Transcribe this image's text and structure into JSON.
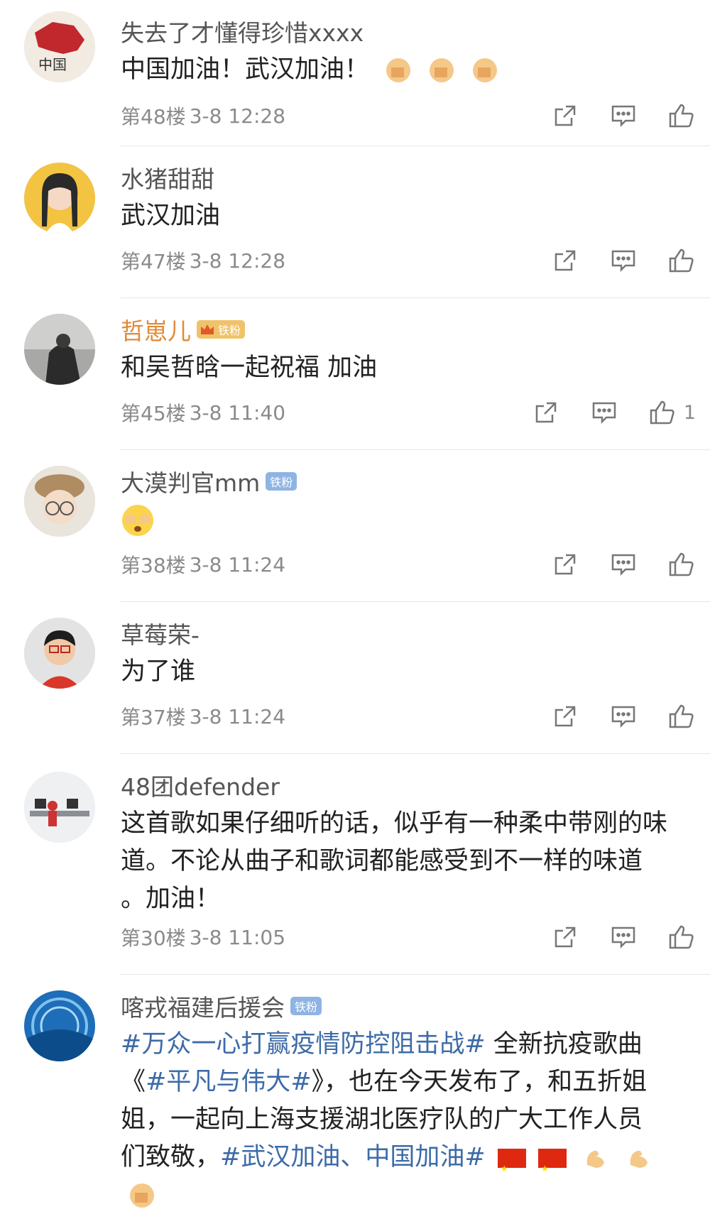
{
  "comments": [
    {
      "name": "失去了才懂得珍惜xxxx",
      "text": "中国加油！武汉加油！",
      "floor": "第48楼",
      "date": "3-8 12:28"
    },
    {
      "name": "水猪甜甜",
      "text": "武汉加油",
      "floor": "第47楼",
      "date": "3-8 12:28"
    },
    {
      "name": "哲崽儿",
      "badge": "铁粉",
      "text": "和吴哲晗一起祝福 加油",
      "floor": "第45楼",
      "date": "3-8 11:40",
      "likes": "1"
    },
    {
      "name": "大漠判官mm",
      "badge": "铁粉",
      "floor": "第38楼",
      "date": "3-8 11:24"
    },
    {
      "name": "草莓荣-",
      "text": "为了谁",
      "floor": "第37楼",
      "date": "3-8 11:24"
    },
    {
      "name": "48团defender",
      "text": "这首歌如果仔细听的话，似乎有一种柔中带刚的味道。不论从曲子和歌词都能感受到不一样的味道 。加油！",
      "floor": "第30楼",
      "date": "3-8 11:05"
    },
    {
      "name": "喀戎福建后援会",
      "badge": "铁粉",
      "tag1": "#万众一心打赢疫情防控阻击战#",
      "text_a": " 全新抗疫歌曲《",
      "tag2": "#平凡与伟大#",
      "text_b": "》，也在今天发布了，和五折姐姐，一起向上海支援湖北医疗队的广大工作人员们致敬，",
      "tag3": "#武汉加油、中国加油#"
    }
  ],
  "colors": {
    "link": "#3d6ba8",
    "vip_name": "#e08a38",
    "meta": "#8a8a8a",
    "divider": "#e6e6e6"
  },
  "icons": [
    "share-icon",
    "comment-icon",
    "like-icon"
  ]
}
